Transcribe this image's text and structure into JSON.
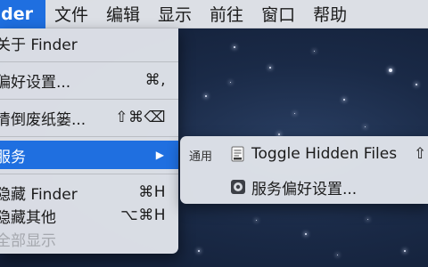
{
  "menubar": {
    "app_label": "nder",
    "items": [
      "文件",
      "编辑",
      "显示",
      "前往",
      "窗口",
      "帮助"
    ]
  },
  "finder_menu": {
    "items": [
      {
        "label": "关于 Finder",
        "shortcut": ""
      },
      {
        "label": "偏好设置...",
        "shortcut": "⌘,"
      },
      {
        "label": "清倒废纸篓...",
        "shortcut": "⇧⌘⌫"
      },
      {
        "label": "服务",
        "shortcut": ""
      },
      {
        "label": "隐藏 Finder",
        "shortcut": "⌘H"
      },
      {
        "label": "隐藏其他",
        "shortcut": "⌥⌘H"
      },
      {
        "label": "全部显示",
        "shortcut": ""
      }
    ]
  },
  "services_submenu": {
    "heading": "通用",
    "items": [
      {
        "label": "Toggle Hidden Files",
        "shortcut": "⇧"
      },
      {
        "label": "服务偏好设置..."
      }
    ]
  },
  "colors": {
    "highlight": "#1f6fe0",
    "menu_bg": "#e4e7ed",
    "desktop": "#1a2a47"
  }
}
